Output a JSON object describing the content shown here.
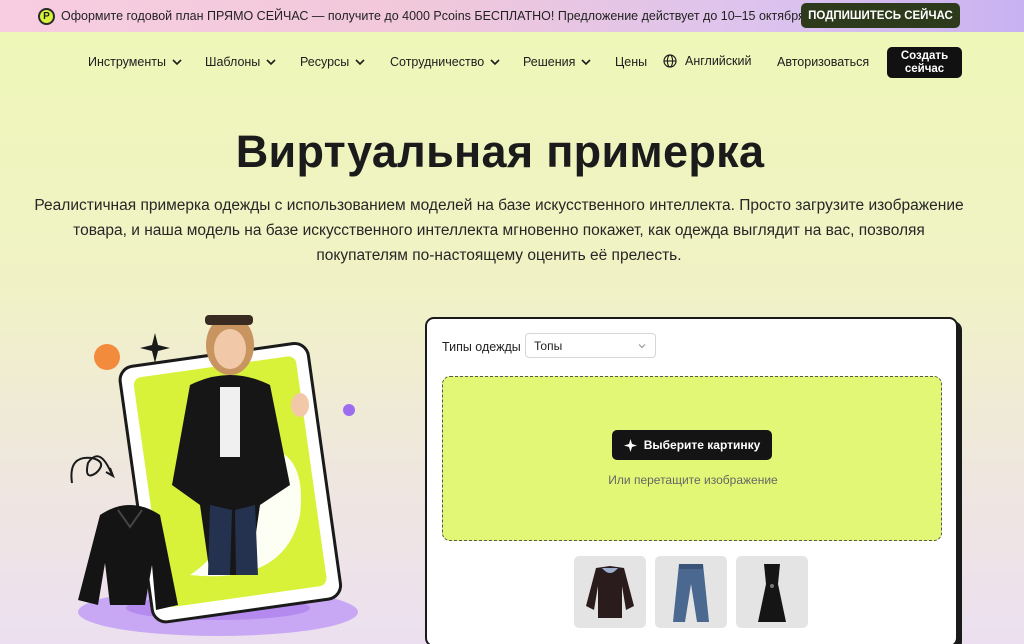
{
  "promo": {
    "text": "Оформите годовой план ПРЯМО СЕЙЧАС — получите до 4000 Pcoins БЕСПЛАТНО! Предложение действует до 10–15 октября.",
    "button_label": "ПОДПИШИТЕСЬ СЕЙЧАС",
    "coin_icon": "pcoin-icon"
  },
  "nav": {
    "items": [
      {
        "label": "Инструменты"
      },
      {
        "label": "Шаблоны"
      },
      {
        "label": "Ресурсы"
      },
      {
        "label": "Сотрудничество"
      },
      {
        "label": "Решения"
      }
    ],
    "pricing_label": "Цены",
    "language_label": "Английский",
    "login_label": "Авторизоваться",
    "create_label": "Создать сейчас"
  },
  "hero": {
    "title": "Виртуальная примерка",
    "subtitle": "Реалистичная примерка одежды с использованием моделей на базе искусственного интеллекта. Просто загрузите изображение товара, и наша модель на базе искусственного интеллекта мгновенно покажет, как одежда выглядит на вас, позволяя покупателям по-настоящему оценить её прелесть."
  },
  "tryon": {
    "type_label": "Типы одежды",
    "type_selected": "Топы",
    "pick_button": "Выберите картинку",
    "drop_hint": "Или перетащите изображение",
    "samples": [
      "sweater-sample",
      "jeans-sample",
      "dress-sample"
    ]
  },
  "colors": {
    "accent_lime": "#e2f775",
    "dark": "#141414"
  }
}
